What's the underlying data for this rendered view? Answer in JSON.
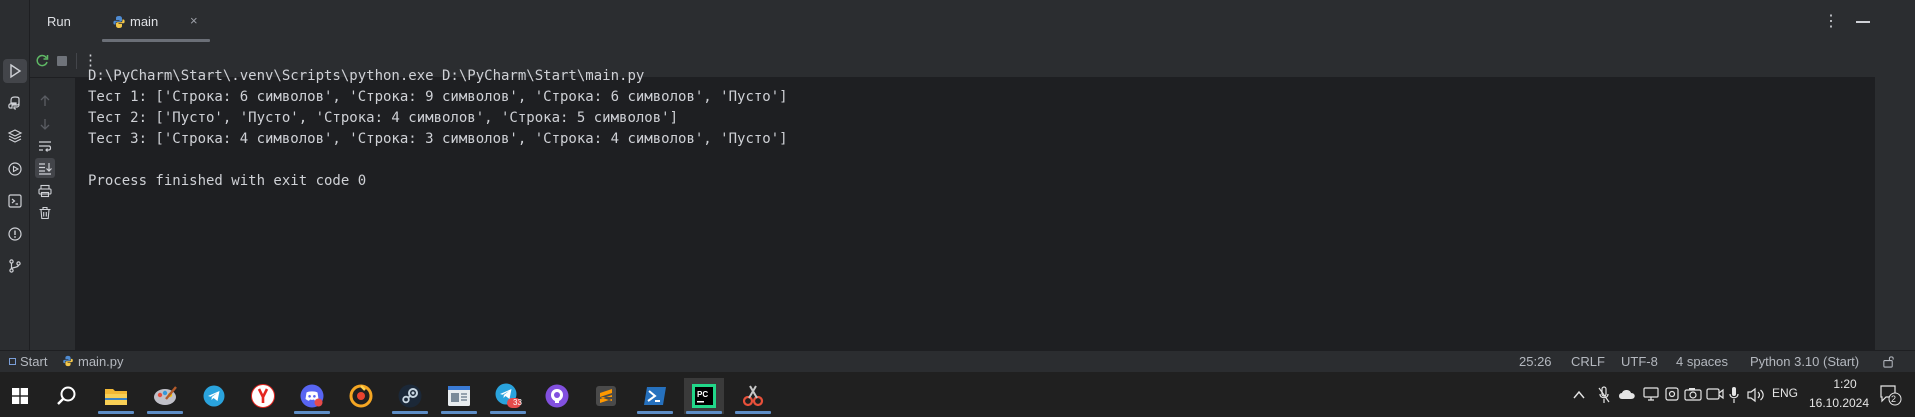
{
  "header": {
    "run_label": "Run",
    "tab_label": "main",
    "tab_close": "×",
    "menu_glyph": "⋮"
  },
  "toolbar": {
    "more_glyph": "⋮"
  },
  "console": {
    "lines": [
      "D:\\PyCharm\\Start\\.venv\\Scripts\\python.exe D:\\PyCharm\\Start\\main.py",
      "Тест 1: ['Строка: 6 символов', 'Строка: 9 символов', 'Строка: 6 символов', 'Пусто']",
      "Тест 2: ['Пусто', 'Пусто', 'Строка: 4 символов', 'Строка: 5 символов']",
      "Тест 3: ['Строка: 4 символов', 'Строка: 3 символов', 'Строка: 4 символов', 'Пусто']",
      "",
      "Process finished with exit code 0"
    ]
  },
  "statusbar": {
    "project": "Start",
    "file": "main.py",
    "position": "25:26",
    "line_sep": "CRLF",
    "encoding": "UTF-8",
    "indent": "4 spaces",
    "interpreter": "Python 3.10 (Start)"
  },
  "taskbar": {
    "lang": "ENG",
    "time": "1:20",
    "date": "16.10.2024",
    "telegram_badge": "33",
    "notif_count": "2",
    "apps": [
      "start-icon",
      "search-icon",
      "file-explorer-icon",
      "paint-icon",
      "telegram-icon",
      "yandex-browser-icon",
      "discord-icon",
      "music-player-icon",
      "steam-icon",
      "notes-icon",
      "telegram-desktop-icon",
      "github-desktop-icon",
      "sublime-text-icon",
      "powershell-icon",
      "pycharm-icon",
      "snipping-tool-icon"
    ]
  },
  "colors": {
    "ide_bg": "#1e1f22",
    "panel_bg": "#2b2d30",
    "taskbar_bg": "#202020",
    "accent_blue": "#5e8ec7",
    "pycharm_green": "#21d789"
  }
}
